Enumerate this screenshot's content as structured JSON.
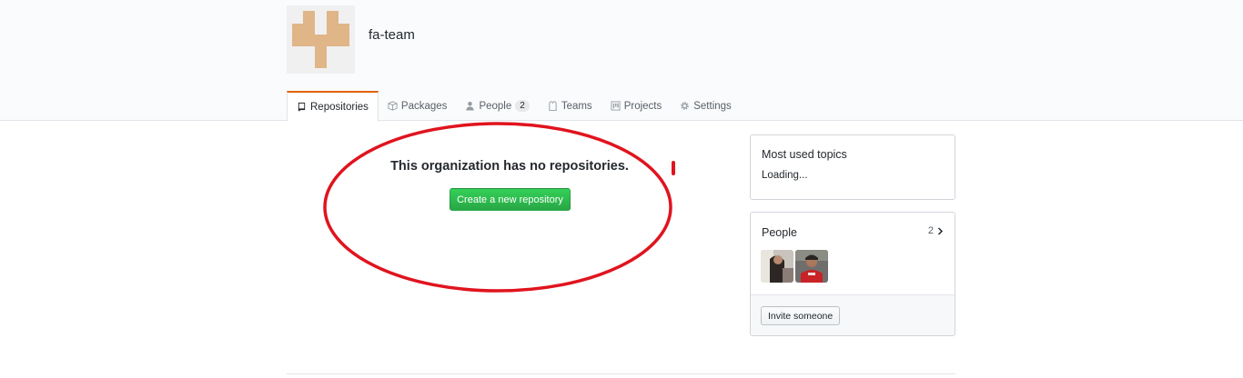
{
  "org": {
    "name": "fa-team",
    "avatar_icon": "identicon",
    "avatar_color": "#e0b587"
  },
  "tabs": [
    {
      "label": "Repositories",
      "icon": "repo-icon",
      "selected": true
    },
    {
      "label": "Packages",
      "icon": "package-icon"
    },
    {
      "label": "People",
      "icon": "person-icon",
      "count": "2"
    },
    {
      "label": "Teams",
      "icon": "jersey-icon"
    },
    {
      "label": "Projects",
      "icon": "project-icon"
    },
    {
      "label": "Settings",
      "icon": "gear-icon"
    }
  ],
  "blankslate": {
    "title": "This organization has no repositories.",
    "create_button": "Create a new repository"
  },
  "sidebar": {
    "topics": {
      "title": "Most used topics",
      "status": "Loading..."
    },
    "people": {
      "title": "People",
      "count": "2",
      "invite_button": "Invite someone"
    }
  },
  "colors": {
    "accent_tab": "#e36209",
    "primary_button": "#28a745",
    "annotation": "#e0141e"
  }
}
